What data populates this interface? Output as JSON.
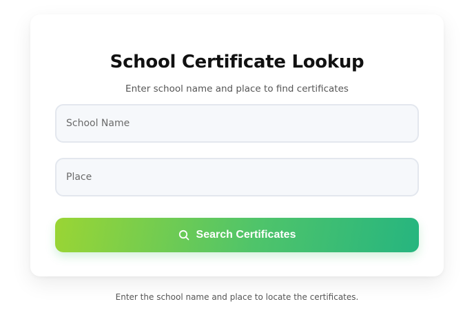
{
  "card": {
    "title": "School Certificate Lookup",
    "subtitle": "Enter school name and place to find certificates"
  },
  "form": {
    "school_name": {
      "value": "",
      "placeholder": "School Name"
    },
    "place": {
      "value": "",
      "placeholder": "Place"
    },
    "search_button": {
      "label": "Search Certificates",
      "icon": "search-icon"
    }
  },
  "footer": {
    "note": "Enter the school name and place to locate the certificates."
  },
  "colors": {
    "button_gradient_start": "#9ad534",
    "button_gradient_end": "#26b57f",
    "input_background": "#f6f8fb",
    "input_border": "#e3e7ee",
    "title_text": "#111111"
  }
}
